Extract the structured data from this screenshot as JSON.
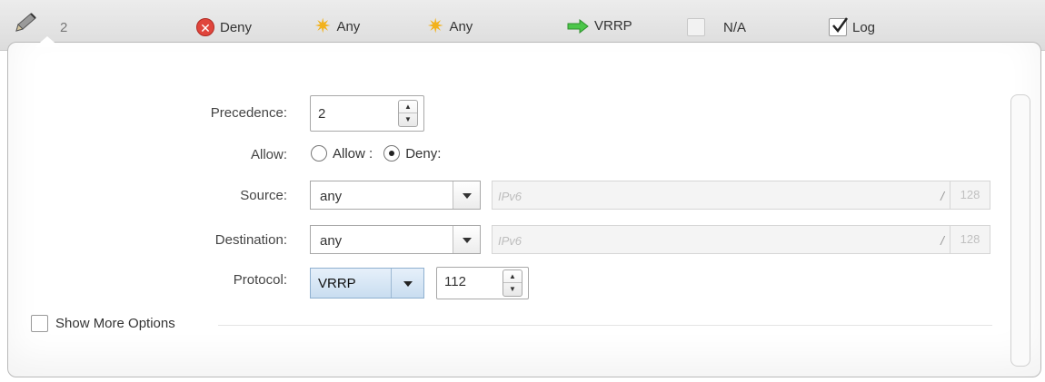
{
  "header": {
    "rule_number": "2",
    "action": "Deny",
    "source": "Any",
    "destination": "Any",
    "protocol": "VRRP",
    "na_label": "N/A",
    "log_label": "Log",
    "log_checked": true
  },
  "form": {
    "precedence": {
      "label": "Precedence:",
      "value": "2"
    },
    "allow": {
      "label": "Allow:",
      "option_allow": "Allow :",
      "option_deny": "Deny:",
      "selected": "Deny"
    },
    "source": {
      "label": "Source:",
      "value": "any",
      "ip_placeholder": "IPv6",
      "slash": "/",
      "mask": "128"
    },
    "destination": {
      "label": "Destination:",
      "value": "any",
      "ip_placeholder": "IPv6",
      "slash": "/",
      "mask": "128"
    },
    "protocol": {
      "label": "Protocol:",
      "value": "VRRP",
      "number": "112"
    },
    "show_more": {
      "label": "Show  More Options",
      "checked": false
    }
  },
  "colors": {
    "deny": "#e0453c",
    "any_star": "#f2b21c",
    "arrow": "#3cbf3c",
    "protocol_bg": "#c9ddf0"
  },
  "icons": [
    "pencil-icon",
    "deny-icon",
    "any-star-icon",
    "arrow-right-icon",
    "checkbox-icon"
  ]
}
